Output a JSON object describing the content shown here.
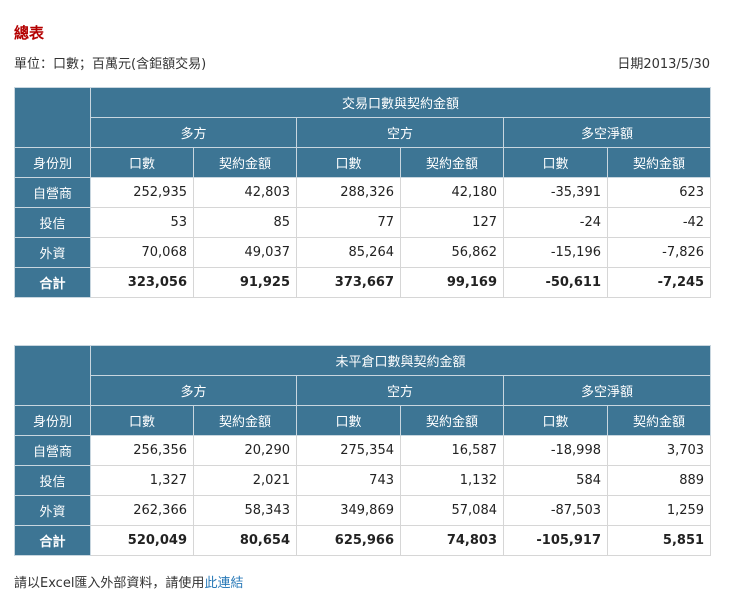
{
  "page": {
    "title": "總表",
    "unit": "單位：口數；百萬元(含鉅額交易)",
    "date": "日期2013/5/30"
  },
  "headers": {
    "long": "多方",
    "short": "空方",
    "net": "多空淨額",
    "identity": "身份別",
    "contracts": "口數",
    "amount": "契約金額"
  },
  "tables": [
    {
      "title": "交易口數與契約金額",
      "rows": [
        {
          "label": "自營商",
          "cells": [
            "252,935",
            "42,803",
            "288,326",
            "42,180",
            "-35,391",
            "623"
          ]
        },
        {
          "label": "投信",
          "cells": [
            "53",
            "85",
            "77",
            "127",
            "-24",
            "-42"
          ]
        },
        {
          "label": "外資",
          "cells": [
            "70,068",
            "49,037",
            "85,264",
            "56,862",
            "-15,196",
            "-7,826"
          ]
        },
        {
          "label": "合計",
          "cells": [
            "323,056",
            "91,925",
            "373,667",
            "99,169",
            "-50,611",
            "-7,245"
          ]
        }
      ]
    },
    {
      "title": "未平倉口數與契約金額",
      "rows": [
        {
          "label": "自營商",
          "cells": [
            "256,356",
            "20,290",
            "275,354",
            "16,587",
            "-18,998",
            "3,703"
          ]
        },
        {
          "label": "投信",
          "cells": [
            "1,327",
            "2,021",
            "743",
            "1,132",
            "584",
            "889"
          ]
        },
        {
          "label": "外資",
          "cells": [
            "262,366",
            "58,343",
            "349,869",
            "57,084",
            "-87,503",
            "1,259"
          ]
        },
        {
          "label": "合計",
          "cells": [
            "520,049",
            "80,654",
            "625,966",
            "74,803",
            "-105,917",
            "5,851"
          ]
        }
      ]
    }
  ],
  "footer": {
    "text": "請以Excel匯入外部資料，請使用",
    "link": "此連結"
  }
}
